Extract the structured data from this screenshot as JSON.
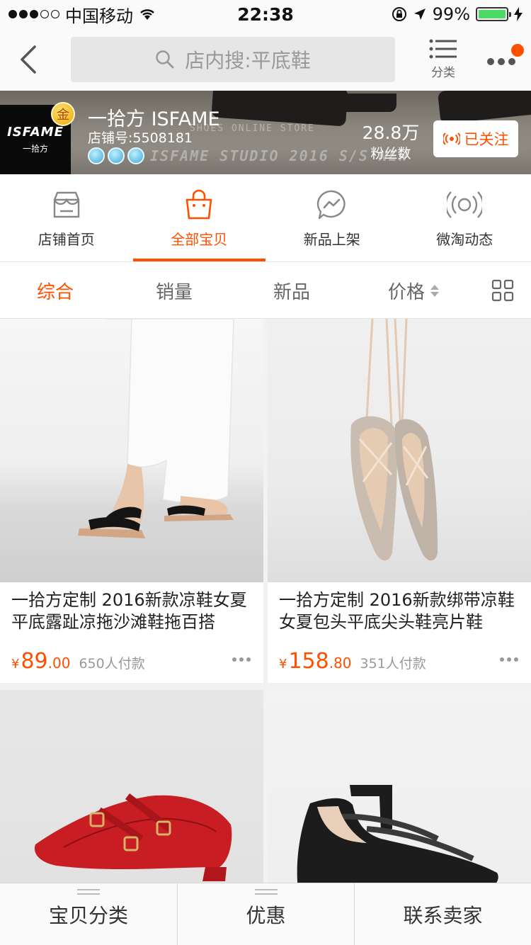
{
  "status_bar": {
    "carrier": "中国移动",
    "time": "22:38",
    "battery": "99%",
    "battery_level": 0.99
  },
  "nav": {
    "search_placeholder": "店内搜:平底鞋",
    "category_label": "分类"
  },
  "shop": {
    "logo_text": "ISFAME",
    "logo_sub": "一拾方",
    "gold_badge": "金",
    "name": "一拾方 ISFAME",
    "id": "店铺号:5508181",
    "banner_watermark_1": "SHOES ONLINE STORE",
    "banner_watermark_2": "ISFAME STUDIO 2016 S/S NEW",
    "fans_count": "28.8万",
    "fans_label": "粉丝数",
    "follow_label": "已关注",
    "crown_count": 3
  },
  "tabs": [
    {
      "label": "店铺首页",
      "icon": "store-icon",
      "active": false
    },
    {
      "label": "全部宝贝",
      "icon": "shopping-bag-icon",
      "active": true
    },
    {
      "label": "新品上架",
      "icon": "lightning-chat-icon",
      "active": false
    },
    {
      "label": "微淘动态",
      "icon": "broadcast-icon",
      "active": false
    }
  ],
  "sort": {
    "items": [
      "综合",
      "销量",
      "新品",
      "价格"
    ],
    "active_index": 0,
    "view_icon": "grid-view-icon"
  },
  "products": [
    {
      "title": "一拾方定制 2016新款凉鞋女夏平底露趾凉拖沙滩鞋拖百搭",
      "price_symbol": "¥",
      "price_int": "89",
      "price_dec": ".00",
      "sales": "650人付款"
    },
    {
      "title": "一拾方定制 2016新款绑带凉鞋女夏包头平底尖头鞋亮片鞋",
      "price_symbol": "¥",
      "price_int": "158",
      "price_dec": ".80",
      "sales": "351人付款"
    },
    {
      "title": "",
      "price_symbol": "",
      "price_int": "",
      "price_dec": "",
      "sales": ""
    },
    {
      "title": "",
      "price_symbol": "",
      "price_int": "",
      "price_dec": "",
      "sales": ""
    }
  ],
  "bottom_bar": {
    "items": [
      "宝贝分类",
      "优惠",
      "联系卖家"
    ]
  },
  "colors": {
    "accent": "#ff5000",
    "battery_green": "#4cd964"
  }
}
